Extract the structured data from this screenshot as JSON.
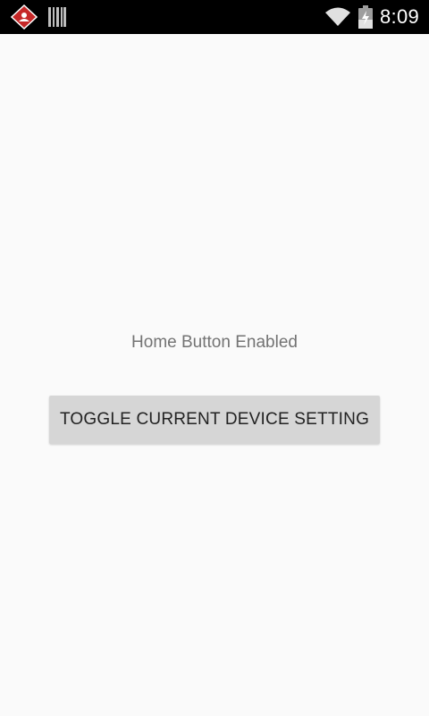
{
  "status_bar": {
    "time": "8:09",
    "icons": [
      "app-alert-icon",
      "barcode-icon",
      "wifi-icon",
      "battery-charging-icon"
    ]
  },
  "main": {
    "status_text": "Home Button Enabled",
    "toggle_button_label": "TOGGLE CURRENT DEVICE SETTING"
  },
  "colors": {
    "status_bar_bg": "#000000",
    "background": "#fafafa",
    "button_bg": "#d6d6d6",
    "status_text": "#737373",
    "alert_icon_red": "#c62828"
  }
}
